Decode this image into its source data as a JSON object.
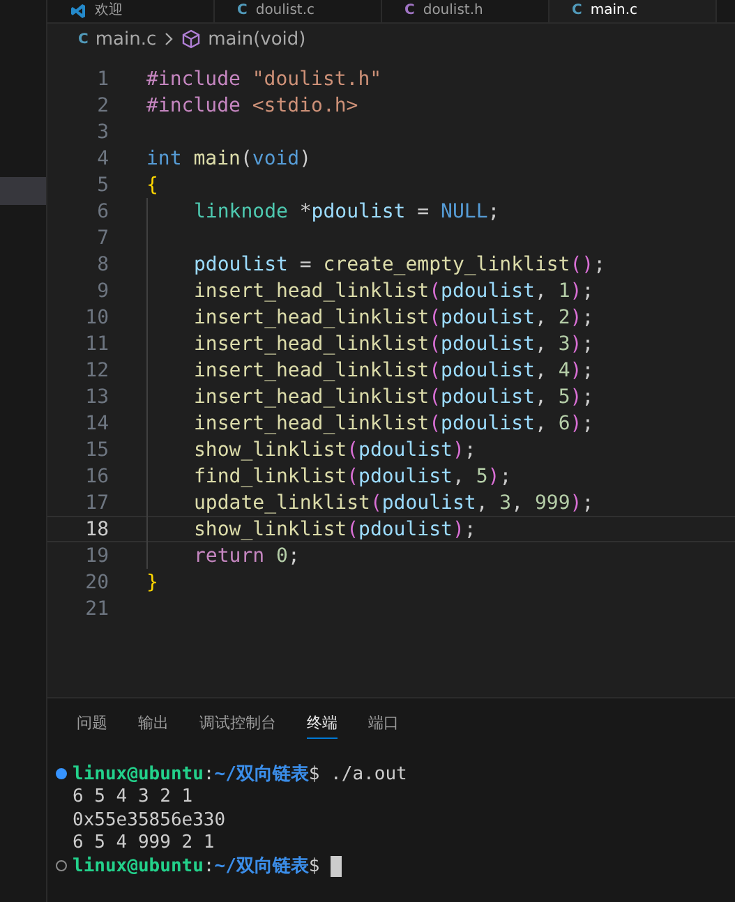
{
  "editor_tabs": [
    {
      "label": "欢迎",
      "kind": "welcome",
      "selected": false
    },
    {
      "label": "doulist.c",
      "kind": "source",
      "icon_text": "C",
      "selected": false
    },
    {
      "label": "doulist.h",
      "kind": "header",
      "icon_text": "C",
      "selected": false
    },
    {
      "label": "main.c",
      "kind": "source",
      "icon_text": "C",
      "selected": true
    }
  ],
  "breadcrumb": {
    "icon_text": "C",
    "file": "main.c",
    "symbol": "main(void)"
  },
  "code_lines": [
    {
      "number": "1",
      "indented": false,
      "current": false,
      "tokens": [
        {
          "text": "#include",
          "kind": "preproc"
        },
        {
          "text": " \"doulist.h\"",
          "kind": "string"
        }
      ]
    },
    {
      "number": "2",
      "indented": false,
      "current": false,
      "tokens": [
        {
          "text": "#include",
          "kind": "preproc"
        },
        {
          "text": " <stdio.h>",
          "kind": "string"
        }
      ]
    },
    {
      "number": "3",
      "indented": false,
      "current": false
    },
    {
      "number": "4",
      "indented": false,
      "current": false,
      "tokens": [
        {
          "text": "int",
          "kind": "keyword"
        },
        {
          "text": " main",
          "kind": "function"
        },
        {
          "text": "(",
          "kind": "plain"
        },
        {
          "text": "void",
          "kind": "keyword"
        },
        {
          "text": ")",
          "kind": "plain"
        }
      ]
    },
    {
      "number": "5",
      "indented": false,
      "current": false,
      "tokens": [
        {
          "text": "{",
          "kind": "brace"
        }
      ]
    },
    {
      "number": "6",
      "indented": true,
      "current": false,
      "tokens": [
        {
          "text": "linknode",
          "kind": "type"
        },
        {
          "text": " *",
          "kind": "plain"
        },
        {
          "text": "pdoulist",
          "kind": "variable"
        },
        {
          "text": " = ",
          "kind": "plain"
        },
        {
          "text": "NULL",
          "kind": "keyword"
        },
        {
          "text": ";",
          "kind": "plain"
        }
      ]
    },
    {
      "number": "7",
      "indented": true,
      "current": false
    },
    {
      "number": "8",
      "indented": true,
      "current": false,
      "tokens": [
        {
          "text": "pdoulist",
          "kind": "variable"
        },
        {
          "text": " = ",
          "kind": "plain"
        },
        {
          "text": "create_empty_linklist",
          "kind": "function"
        },
        {
          "text": "()",
          "kind": "paren"
        },
        {
          "text": ";",
          "kind": "plain"
        }
      ]
    },
    {
      "number": "9",
      "indented": true,
      "current": false,
      "tokens": [
        {
          "text": "insert_head_linklist",
          "kind": "function"
        },
        {
          "text": "(",
          "kind": "paren"
        },
        {
          "text": "pdoulist",
          "kind": "variable"
        },
        {
          "text": ", ",
          "kind": "plain"
        },
        {
          "text": "1",
          "kind": "number"
        },
        {
          "text": ")",
          "kind": "paren"
        },
        {
          "text": ";",
          "kind": "plain"
        }
      ]
    },
    {
      "number": "10",
      "indented": true,
      "current": false,
      "tokens": [
        {
          "text": "insert_head_linklist",
          "kind": "function"
        },
        {
          "text": "(",
          "kind": "paren"
        },
        {
          "text": "pdoulist",
          "kind": "variable"
        },
        {
          "text": ", ",
          "kind": "plain"
        },
        {
          "text": "2",
          "kind": "number"
        },
        {
          "text": ")",
          "kind": "paren"
        },
        {
          "text": ";",
          "kind": "plain"
        }
      ]
    },
    {
      "number": "11",
      "indented": true,
      "current": false,
      "tokens": [
        {
          "text": "insert_head_linklist",
          "kind": "function"
        },
        {
          "text": "(",
          "kind": "paren"
        },
        {
          "text": "pdoulist",
          "kind": "variable"
        },
        {
          "text": ", ",
          "kind": "plain"
        },
        {
          "text": "3",
          "kind": "number"
        },
        {
          "text": ")",
          "kind": "paren"
        },
        {
          "text": ";",
          "kind": "plain"
        }
      ]
    },
    {
      "number": "12",
      "indented": true,
      "current": false,
      "tokens": [
        {
          "text": "insert_head_linklist",
          "kind": "function"
        },
        {
          "text": "(",
          "kind": "paren"
        },
        {
          "text": "pdoulist",
          "kind": "variable"
        },
        {
          "text": ", ",
          "kind": "plain"
        },
        {
          "text": "4",
          "kind": "number"
        },
        {
          "text": ")",
          "kind": "paren"
        },
        {
          "text": ";",
          "kind": "plain"
        }
      ]
    },
    {
      "number": "13",
      "indented": true,
      "current": false,
      "tokens": [
        {
          "text": "insert_head_linklist",
          "kind": "function"
        },
        {
          "text": "(",
          "kind": "paren"
        },
        {
          "text": "pdoulist",
          "kind": "variable"
        },
        {
          "text": ", ",
          "kind": "plain"
        },
        {
          "text": "5",
          "kind": "number"
        },
        {
          "text": ")",
          "kind": "paren"
        },
        {
          "text": ";",
          "kind": "plain"
        }
      ]
    },
    {
      "number": "14",
      "indented": true,
      "current": false,
      "tokens": [
        {
          "text": "insert_head_linklist",
          "kind": "function"
        },
        {
          "text": "(",
          "kind": "paren"
        },
        {
          "text": "pdoulist",
          "kind": "variable"
        },
        {
          "text": ", ",
          "kind": "plain"
        },
        {
          "text": "6",
          "kind": "number"
        },
        {
          "text": ")",
          "kind": "paren"
        },
        {
          "text": ";",
          "kind": "plain"
        }
      ]
    },
    {
      "number": "15",
      "indented": true,
      "current": false,
      "tokens": [
        {
          "text": "show_linklist",
          "kind": "function"
        },
        {
          "text": "(",
          "kind": "paren"
        },
        {
          "text": "pdoulist",
          "kind": "variable"
        },
        {
          "text": ")",
          "kind": "paren"
        },
        {
          "text": ";",
          "kind": "plain"
        }
      ]
    },
    {
      "number": "16",
      "indented": true,
      "current": false,
      "tokens": [
        {
          "text": "find_linklist",
          "kind": "function"
        },
        {
          "text": "(",
          "kind": "paren"
        },
        {
          "text": "pdoulist",
          "kind": "variable"
        },
        {
          "text": ", ",
          "kind": "plain"
        },
        {
          "text": "5",
          "kind": "number"
        },
        {
          "text": ")",
          "kind": "paren"
        },
        {
          "text": ";",
          "kind": "plain"
        }
      ]
    },
    {
      "number": "17",
      "indented": true,
      "current": false,
      "tokens": [
        {
          "text": "update_linklist",
          "kind": "function"
        },
        {
          "text": "(",
          "kind": "paren"
        },
        {
          "text": "pdoulist",
          "kind": "variable"
        },
        {
          "text": ", ",
          "kind": "plain"
        },
        {
          "text": "3",
          "kind": "number"
        },
        {
          "text": ", ",
          "kind": "plain"
        },
        {
          "text": "999",
          "kind": "number"
        },
        {
          "text": ")",
          "kind": "paren"
        },
        {
          "text": ";",
          "kind": "plain"
        }
      ]
    },
    {
      "number": "18",
      "indented": true,
      "current": true,
      "tokens": [
        {
          "text": "show_linklist",
          "kind": "function"
        },
        {
          "text": "(",
          "kind": "paren"
        },
        {
          "text": "pdoulist",
          "kind": "variable"
        },
        {
          "text": ")",
          "kind": "paren"
        },
        {
          "text": ";",
          "kind": "plain"
        }
      ]
    },
    {
      "number": "19",
      "indented": true,
      "current": false,
      "tokens": [
        {
          "text": "return",
          "kind": "control"
        },
        {
          "text": " 0",
          "kind": "number"
        },
        {
          "text": ";",
          "kind": "plain"
        }
      ]
    },
    {
      "number": "20",
      "indented": false,
      "current": false,
      "tokens": [
        {
          "text": "}",
          "kind": "brace"
        }
      ]
    },
    {
      "number": "21",
      "indented": false,
      "current": false
    }
  ],
  "panel_tabs": [
    {
      "label": "问题",
      "selected": false
    },
    {
      "label": "输出",
      "selected": false
    },
    {
      "label": "调试控制台",
      "selected": false
    },
    {
      "label": "终端",
      "selected": true
    },
    {
      "label": "端口",
      "selected": false
    }
  ],
  "terminal_lines": [
    {
      "kind": "prompt",
      "succeeded": true,
      "user": "linux@ubuntu",
      "sep": ":",
      "path": "~/双向链表",
      "symbol": "$",
      "command": "./a.out"
    },
    {
      "kind": "output",
      "text": "6 5 4 3 2 1"
    },
    {
      "kind": "output",
      "text": "0x55e35856e330"
    },
    {
      "kind": "output",
      "text": "6 5 4 999 2 1"
    },
    {
      "kind": "prompt",
      "succeeded": false,
      "user": "linux@ubuntu",
      "sep": ":",
      "path": "~/双向链表",
      "symbol": "$",
      "cursor": true
    }
  ]
}
